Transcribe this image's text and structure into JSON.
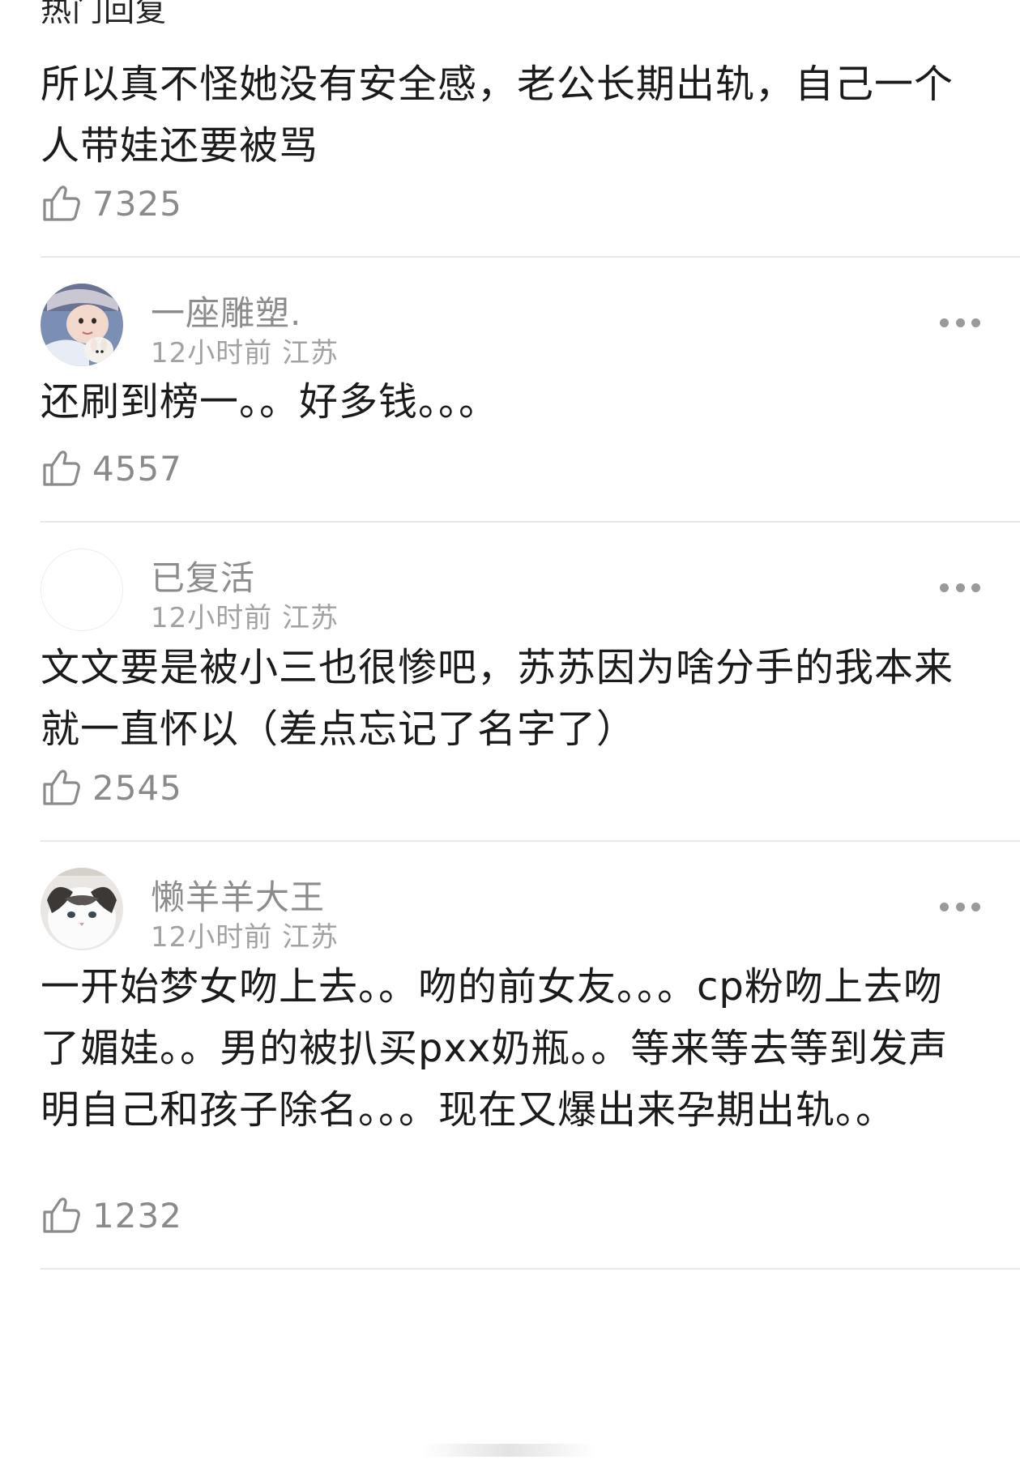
{
  "header": {
    "title": "热门回复"
  },
  "first_reply": {
    "text": "所以真不怪她没有安全感，老公长期出轨，自己一个人带娃还要被骂",
    "likes": "7325"
  },
  "comments": [
    {
      "username": "一座雕塑.",
      "time": "12小时前",
      "location": "江苏",
      "text": "还刷到榜一。。好多钱。。。",
      "likes": "4557"
    },
    {
      "username": "已复活",
      "time": "12小时前",
      "location": "江苏",
      "text": "文文要是被小三也很惨吧，苏苏因为啥分手的我本来就一直怀以（差点忘记了名字了）",
      "likes": "2545"
    },
    {
      "username": "懒羊羊大王",
      "time": "12小时前",
      "location": "江苏",
      "text": "一开始梦女吻上去。。吻的前女友。。。cp粉吻上去吻了媚娃。。男的被扒买pxx奶瓶。。等来等去等到发声明自己和孩子除名。。。现在又爆出来孕期出轨。。",
      "likes": "1232"
    }
  ],
  "icons": {
    "like": "thumbs-up-icon",
    "more": "more-dots-icon"
  },
  "colors": {
    "text": "#1b1b1b",
    "muted": "#8c8c8c",
    "divider": "#e8e8e8"
  }
}
